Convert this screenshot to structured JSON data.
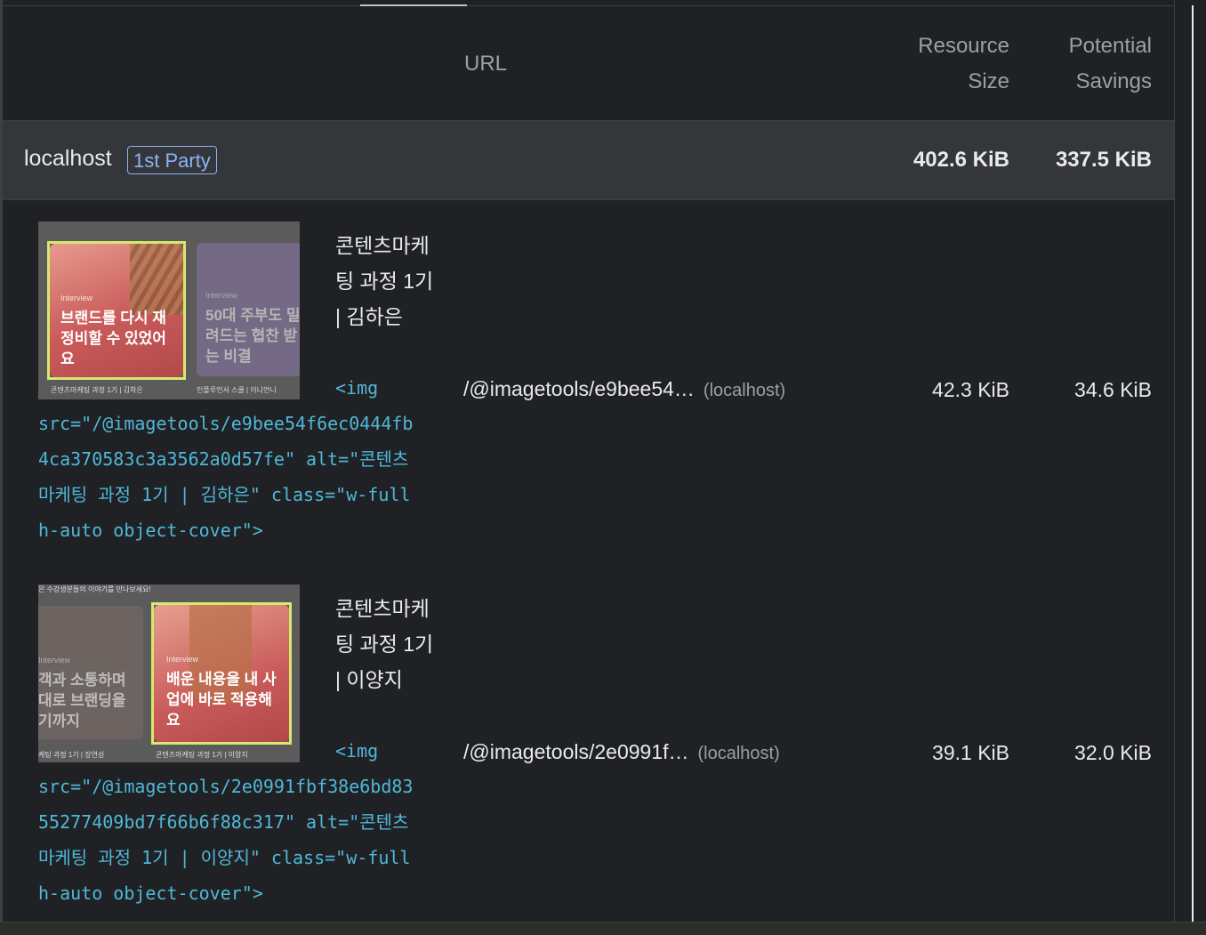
{
  "header": {
    "url": "URL",
    "resource_size": "Resource Size",
    "potential_savings": "Potential Savings"
  },
  "group": {
    "entity": "localhost",
    "badge": "1st Party",
    "resource_size": "402.6 KiB",
    "potential_savings": "337.5 KiB"
  },
  "rows": [
    {
      "label": "콘텐츠마케팅 과정 1기 | 김하은",
      "snippet_l1": "<img",
      "snippet_l2": "src=\"/@imagetools/e9bee54f6ec0444fb",
      "snippet_l3": "4ca370583c3a3562a0d57fe\" alt=\"콘텐츠",
      "snippet_l4": "마케팅 과정 1기 | 김하은\" class=\"w-full",
      "snippet_l5": "h-auto object-cover\">",
      "url": "/@imagetools/e9bee54…",
      "host": "(localhost)",
      "resource_size": "42.3 KiB",
      "potential_savings": "34.6 KiB",
      "thumb": {
        "tag": "Interview",
        "card_main": "브랜드를 다시 재정비할 수 있었어요",
        "card_side": "50대 주부도 밀려드는 협찬 받는 비결",
        "caption_main": "콘텐츠마케팅 과정 1기 | 김하은",
        "caption_side": "인플루언서 스쿨 | 이니언니"
      }
    },
    {
      "label": "콘텐츠마케팅 과정 1기 | 이양지",
      "snippet_l1": "<img",
      "snippet_l2": "src=\"/@imagetools/2e0991fbf38e6bd83",
      "snippet_l3": "55277409bd7f66b6f88c317\" alt=\"콘텐츠",
      "snippet_l4": "마케팅 과정 1기 | 이양지\" class=\"w-full",
      "snippet_l5": "h-auto object-cover\">",
      "url": "/@imagetools/2e0991f…",
      "host": "(localhost)",
      "resource_size": "39.1 KiB",
      "potential_savings": "32.0 KiB",
      "thumb": {
        "tag": "Interview",
        "card_main": "배운 내용을 내 사업에 바로 적용해요",
        "card_side": "객과 소통하며 대로 브랜딩을 기까지",
        "caption_main": "콘텐츠마케팅 과정 1기 | 이양지",
        "caption_side": "케팅 과정 1기 | 장연성",
        "top_caption": "은 수강생분들의 이야기를 만나보세요!"
      }
    }
  ],
  "colors": {
    "link": "#4fb8d8",
    "badge": "#8ab4f8",
    "highlight": "#d7e86a",
    "card_red": "#c95a5a"
  }
}
